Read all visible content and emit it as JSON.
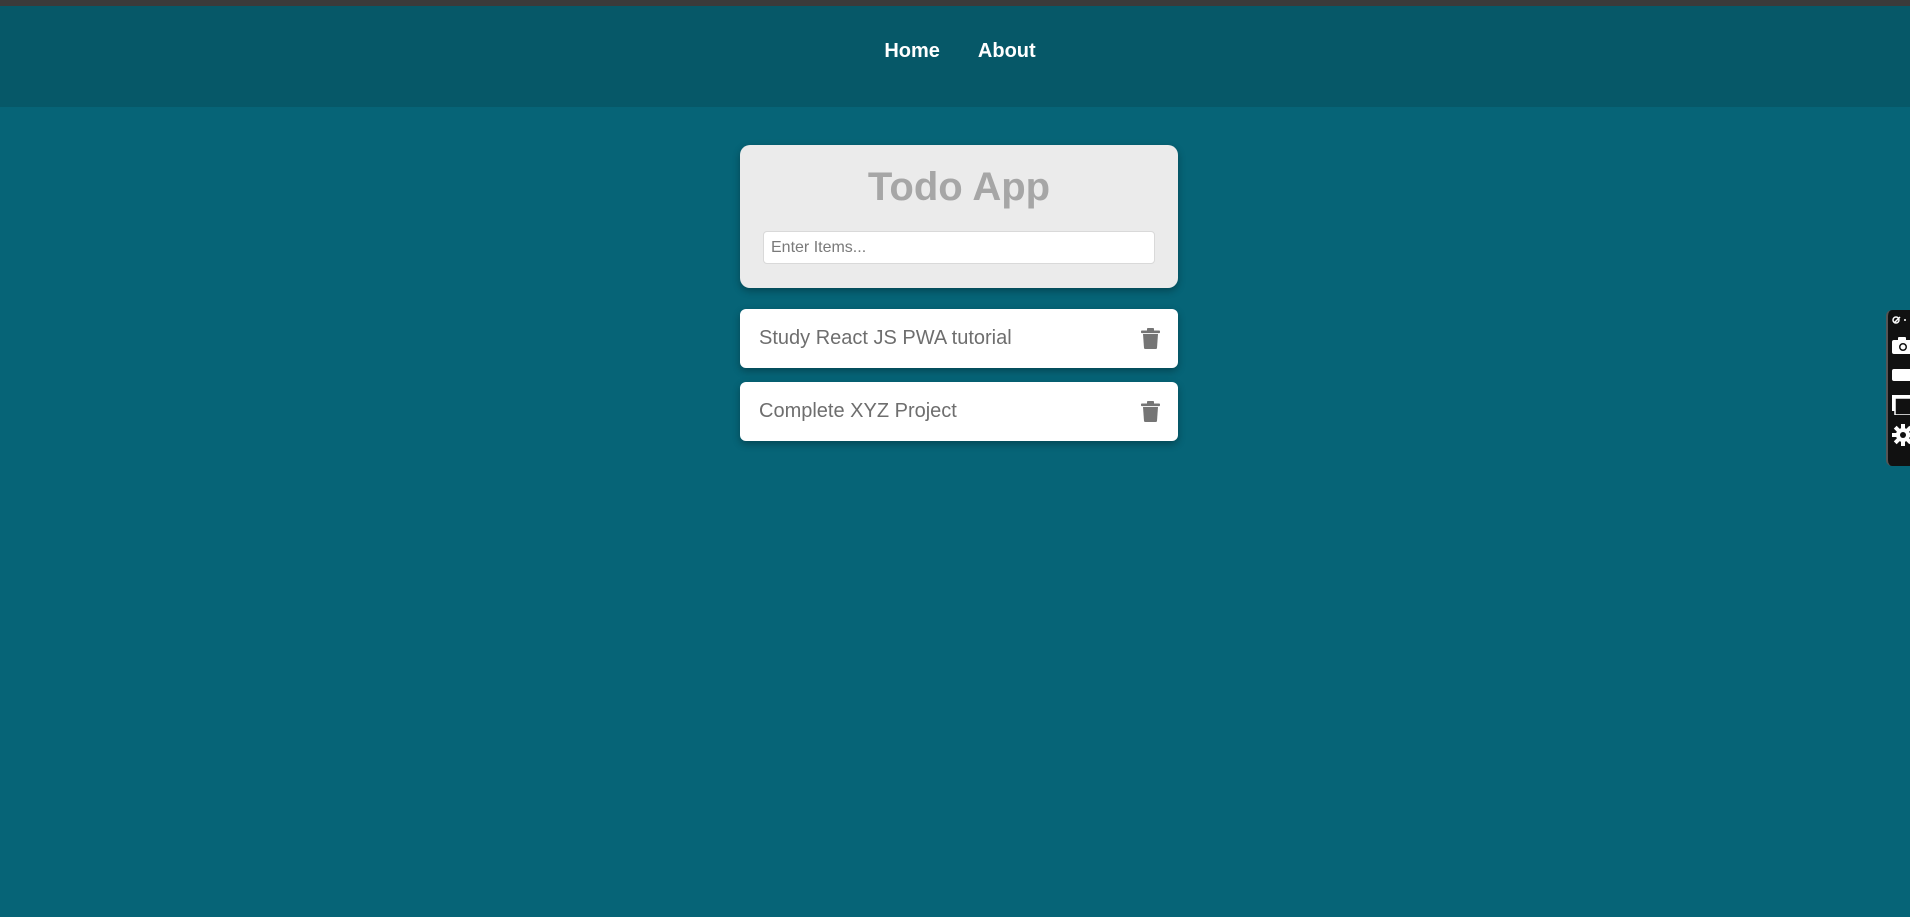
{
  "nav": {
    "links": [
      {
        "label": "Home"
      },
      {
        "label": "About"
      }
    ]
  },
  "app": {
    "title": "Todo App",
    "input_placeholder": "Enter Items...",
    "input_value": ""
  },
  "todos": [
    {
      "text": "Study React JS PWA tutorial",
      "icon": "trash-icon"
    },
    {
      "text": "Complete XYZ Project",
      "icon": "trash-icon"
    }
  ],
  "side_toolbar": {
    "icons": [
      "link-icon",
      "camera-icon",
      "video-icon",
      "window-icon",
      "gear-icon"
    ]
  },
  "colors": {
    "page_bg": "#066477",
    "navbar_bg": "#065868",
    "card_bg": "#ebebeb",
    "title_color": "#a6a6a6",
    "todo_text": "#6e6e6e"
  }
}
